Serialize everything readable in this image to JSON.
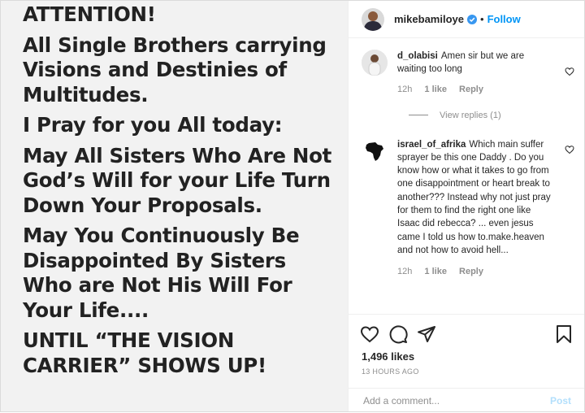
{
  "post": {
    "image_text": [
      "ATTENTION!",
      "All Single Brothers carrying\nVisions and Destinies of\nMultitudes.",
      "I Pray for you All today:",
      "May All Sisters Who Are Not\nGod’s Will for your Life Turn\nDown Your Proposals.",
      "May You Continuously Be\nDisappointed By Sisters\nWho are Not His Will For\nYour Life....",
      "UNTIL “THE VISION\nCARRIER” SHOWS UP!"
    ]
  },
  "header": {
    "username": "mikebamiloye",
    "separator": "•",
    "follow_label": "Follow",
    "more_icon": "more-icon"
  },
  "comments": [
    {
      "username": "d_olabisi",
      "text": "Amen sir but we are waiting too long",
      "time": "12h",
      "likes": "1 like",
      "reply_label": "Reply",
      "view_replies": "View replies (1)"
    },
    {
      "username": "israel_of_afrika",
      "text": "Which main suffer sprayer be this one Daddy . Do you know how or what it takes to go from one disappointment or heart break to another??? Instead why not just pray for them to find the right one like Isaac did rebecca? ... even jesus came I told us how to.make.heaven and not how to avoid hell...",
      "time": "12h",
      "likes": "1 like",
      "reply_label": "Reply"
    }
  ],
  "actions": {
    "likes_count": "1,496 likes",
    "timestamp": "13 HOURS AGO",
    "comment_placeholder": "Add a comment...",
    "post_label": "Post"
  },
  "colors": {
    "accent": "#0095f6",
    "muted": "#8e8e8e",
    "post_disabled": "#b2dffc"
  }
}
